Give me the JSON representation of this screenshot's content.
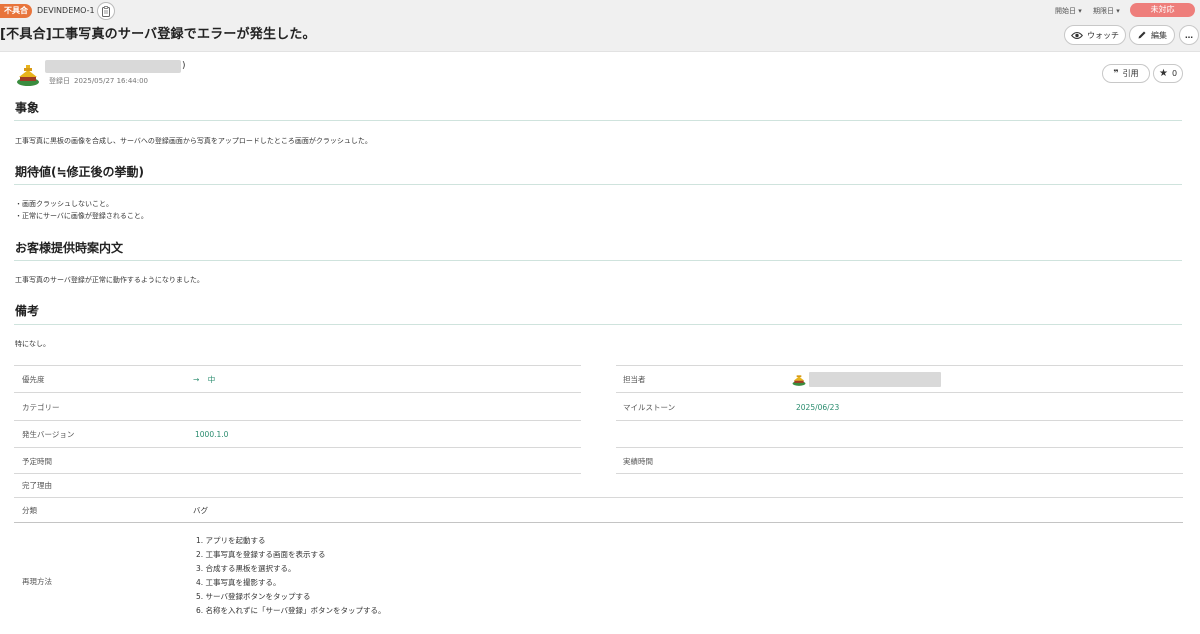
{
  "issue": {
    "type_badge": "不具合",
    "key": "DEVINDEMO-1",
    "title": "[不具合]工事写真のサーバ登録でエラーが発生した。",
    "status": "未対応",
    "start_date_label": "開始日",
    "due_date_label": "期限日"
  },
  "actions": {
    "watch": "ウォッチ",
    "edit": "編集",
    "more": "…",
    "quote": "引用",
    "star_count": "0"
  },
  "author": {
    "name_suffix": ")",
    "registered_label": "登録日",
    "registered_at": "2025/05/27 16:44:00"
  },
  "sections": [
    {
      "heading": "事象",
      "lines": [
        "工事写真に黒板の画像を合成し、サーバへの登録画面から写真をアップロードしたところ画面がクラッシュした。"
      ]
    },
    {
      "heading": "期待値(≒修正後の挙動)",
      "lines": [
        "・画面クラッシュしないこと。",
        "・正常にサーバに画像が登録されること。"
      ]
    },
    {
      "heading": "お客様提供時案内文",
      "lines": [
        "工事写真のサーバ登録が正常に動作するようになりました。"
      ]
    },
    {
      "heading": "備考",
      "lines": [
        "特になし。"
      ]
    }
  ],
  "properties": {
    "priority_label": "優先度",
    "priority_value": "中",
    "assignee_label": "担当者",
    "category_label": "カテゴリー",
    "milestone_label": "マイルストーン",
    "milestone_value": "2025/06/23",
    "version_label": "発生バージョン",
    "version_value": "1000.1.0",
    "planned_time_label": "予定時間",
    "actual_time_label": "実績時間",
    "resolution_label": "完了理由",
    "classification_label": "分類",
    "classification_value": "バグ",
    "repro_label": "再現方法",
    "repro_steps": [
      "1. アプリを起動する",
      "2. 工事写真を登録する画面を表示する",
      "3. 合成する黒板を選択する。",
      "4. 工事写真を撮影する。",
      "5. サーバ登録ボタンをタップする",
      "6. 名称を入れずに「サーバ登録」ボタンをタップする。"
    ]
  },
  "colors": {
    "type_badge": "#e8743b",
    "status": "#ee7e7b",
    "accent_link": "#2a8c6e",
    "section_rule": "#cfe3dd"
  }
}
